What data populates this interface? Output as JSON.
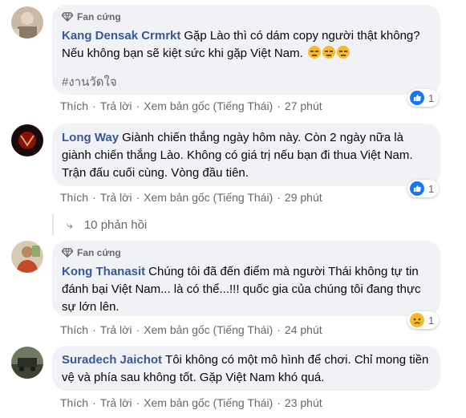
{
  "comments": [
    {
      "badge": "Fan cứng",
      "author": "Kang Densak Crmrkt",
      "text": "Gặp Lào thì có dám copy người thật không? Nếu không bạn sẽ kiệt sức khi gặp Việt Nam.",
      "emojis": [
        "expressionless-face",
        "expressionless-face",
        "expressionless-face"
      ],
      "hashtag": "#งานวัดใจ",
      "actions": {
        "like": "Thích",
        "reply": "Trả lời",
        "original": "Xem bản gốc (Tiếng Thái)",
        "time": "27 phút"
      },
      "reaction": {
        "icon": "like-icon",
        "count": "1"
      }
    },
    {
      "badge": "",
      "author": "Long Way",
      "text": "Giành chiến thắng ngày hôm này. Còn 2 ngày nữa là giành chiến thắng Lào. Không có giá trị nếu bạn đi thua Việt Nam. Trận đấu cuối cùng. Vòng đầu tiên.",
      "actions": {
        "like": "Thích",
        "reply": "Trả lời",
        "original": "Xem bản gốc (Tiếng Thái)",
        "time": "29 phút"
      },
      "reaction": {
        "icon": "like-icon",
        "count": "1"
      }
    },
    {
      "badge": "Fan cứng",
      "author": "Kong Thanasit",
      "text": "Chúng tôi đã đến điểm mà người Thái không tự tin đánh bại Việt Nam... là có thể...!!! quốc gia của chúng tôi đang thực sự lớn lên.",
      "actions": {
        "like": "Thích",
        "reply": "Trả lời",
        "original": "Xem bản gốc (Tiếng Thái)",
        "time": "24 phút"
      },
      "reaction": {
        "icon": "sad-icon",
        "count": "1"
      }
    },
    {
      "badge": "",
      "author": "Suradech Jaichot",
      "text": "Tôi không có một mô hình để chơi. Chỉ mong tiền vệ và phía sau không tốt. Gặp Việt Nam khó quá.",
      "actions": {
        "like": "Thích",
        "reply": "Trả lời",
        "original": "Xem bản gốc (Tiếng Thái)",
        "time": "23 phút"
      }
    }
  ],
  "replies": {
    "label": "10 phản hồi",
    "icon": "reply-arrow-icon"
  },
  "colors": {
    "author": "#385898",
    "bubble": "#f0f2f5",
    "meta": "#65676b",
    "like": "#1877f2",
    "sad": "#f7b928"
  }
}
